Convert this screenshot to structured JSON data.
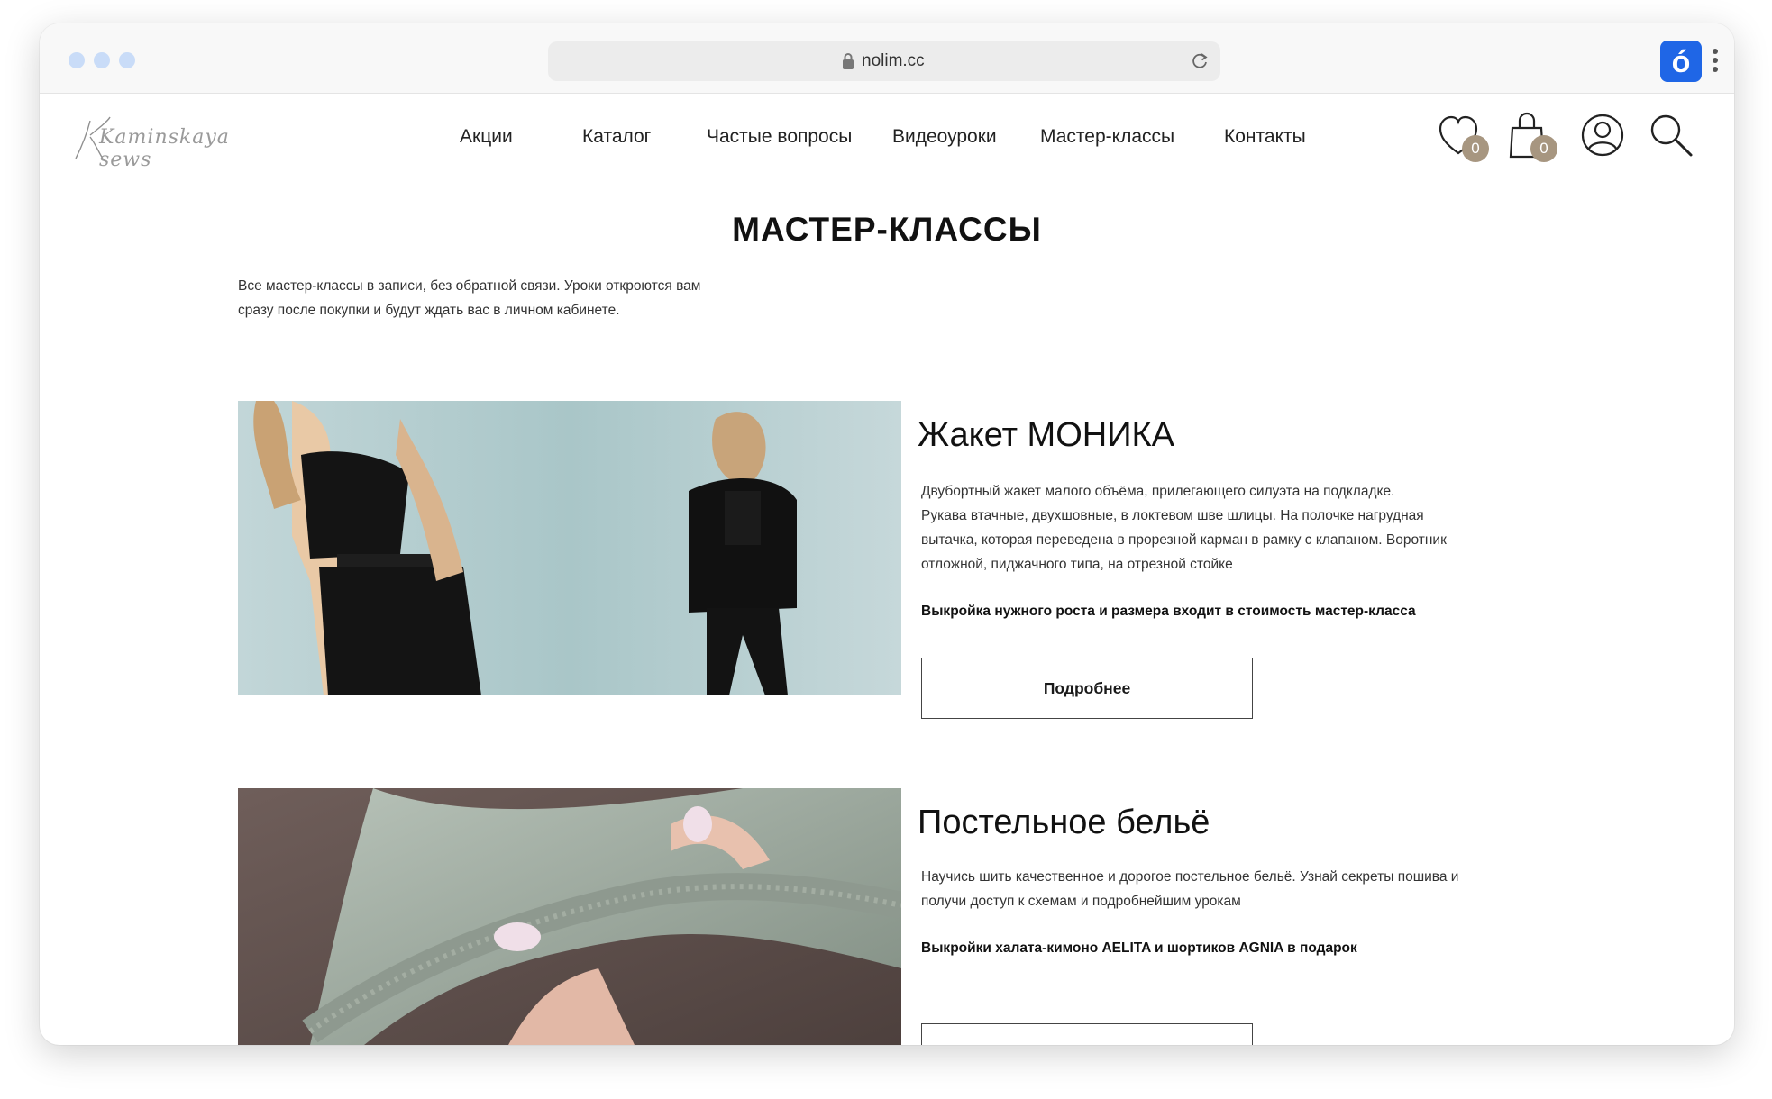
{
  "browser": {
    "url": "nolim.cc",
    "extension_label": "ó"
  },
  "header": {
    "logo_text": "Kaminskaya sews",
    "nav": [
      {
        "label": "Акции"
      },
      {
        "label": "Каталог"
      },
      {
        "label": "Частые вопросы"
      },
      {
        "label": "Видеоуроки"
      },
      {
        "label": "Мастер-классы"
      },
      {
        "label": "Контакты"
      }
    ],
    "wishlist_count": "0",
    "cart_count": "0"
  },
  "page": {
    "title": "МАСТЕР-КЛАССЫ",
    "intro_line1": "Все мастер-классы в записи, без обратной связи. Уроки откроются вам",
    "intro_line2": "сразу после покупки и будут ждать вас в личном кабинете."
  },
  "courses": [
    {
      "title": "Жакет МОНИКА",
      "desc": [
        "Двубортный жакет малого объёма, прилегающего силуэта на подкладке.",
        "Рукава втачные, двухшовные, в локтевом шве шлицы. На полочке нагрудная",
        "вытачка, которая переведена в прорезной карман в рамку с клапаном. Воротник",
        "отложной, пиджачного типа, на отрезной стойке"
      ],
      "bold": "Выкройка нужного роста и размера входит в стоимость мастер-класса",
      "button": "Подробнее"
    },
    {
      "title": "Постельное бельё",
      "desc": [
        "Научись шить качественное и дорогое постельное бельё. Узнай секреты пошива и",
        "получи доступ к схемам и подробнейшим урокам"
      ],
      "bold": "Выкройки халата-кимоно AELITA и шортиков AGNIA в подарок",
      "button": ""
    }
  ],
  "colors": {
    "accent_badge": "#a79680",
    "ext_button": "#1f66e6",
    "dot_light_blue": "#c9dcf8"
  }
}
